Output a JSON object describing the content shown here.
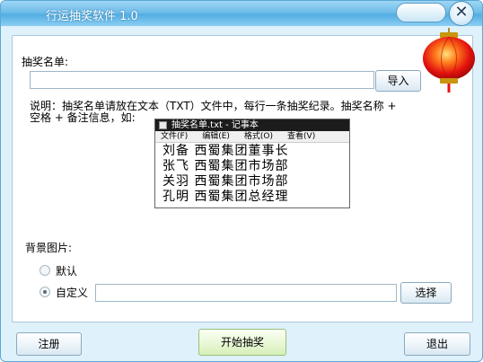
{
  "window": {
    "title": "行运抽奖软件 1.0",
    "close_glyph": "✕"
  },
  "list_section": {
    "label": "抽奖名单:",
    "file_value": "",
    "import_button": "导入",
    "note_line1": "说明：抽奖名单请放在文本（TXT）文件中，每行一条抽奖纪录。抽奖名称 +",
    "note_line2": "空格 + 备注信息，如:"
  },
  "notepad_example": {
    "title": "抽奖名单.txt - 记事本",
    "menu": [
      "文件(F)",
      "编辑(E)",
      "格式(O)",
      "查看(V)"
    ],
    "lines": [
      "刘备 西蜀集团董事长",
      "张飞 西蜀集团市场部",
      "关羽 西蜀集团市场部",
      "孔明 西蜀集团总经理"
    ]
  },
  "background_section": {
    "label": "背景图片:",
    "option_default": "默认",
    "option_custom": "自定义",
    "selected": "custom",
    "custom_path": "",
    "choose_button": "选择"
  },
  "footer": {
    "register_button": "注册",
    "start_button": "开始抽奖",
    "exit_button": "退出"
  },
  "icons": {
    "lantern": "red-lantern-icon"
  }
}
